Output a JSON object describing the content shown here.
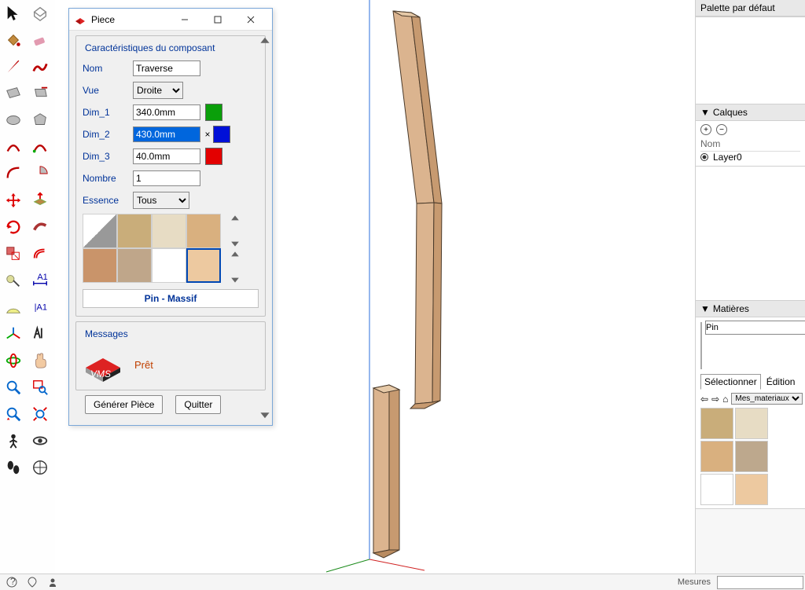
{
  "dialog": {
    "title": "Piece",
    "section_caracteristiques": "Caractéristiques du composant",
    "labels": {
      "nom": "Nom",
      "vue": "Vue",
      "dim1": "Dim_1",
      "dim2": "Dim_2",
      "dim3": "Dim_3",
      "nombre": "Nombre",
      "essence": "Essence"
    },
    "values": {
      "nom": "Traverse",
      "vue": "Droite",
      "dim1": "340.0mm",
      "dim2": "430.0mm",
      "dim3": "40.0mm",
      "nombre": "1",
      "essence": "Tous"
    },
    "colors": {
      "dim1": "#0a9f0a",
      "dim2": "#0010d8",
      "dim3": "#e30000"
    },
    "material_selected_name": "Pin - Massif",
    "section_messages": "Messages",
    "message_text": "Prêt",
    "buttons": {
      "generer": "Générer Pièce",
      "quitter": "Quitter"
    }
  },
  "right": {
    "palette_title": "Palette par défaut",
    "calques_title": "Calques",
    "calques_col_nom": "Nom",
    "layer0": "Layer0",
    "matieres_title": "Matières",
    "material_name": "Pin",
    "tabs": {
      "select": "Sélectionner",
      "edit": "Édition"
    },
    "collection": "Mes_materiaux"
  },
  "status": {
    "mesures": "Mesures"
  }
}
